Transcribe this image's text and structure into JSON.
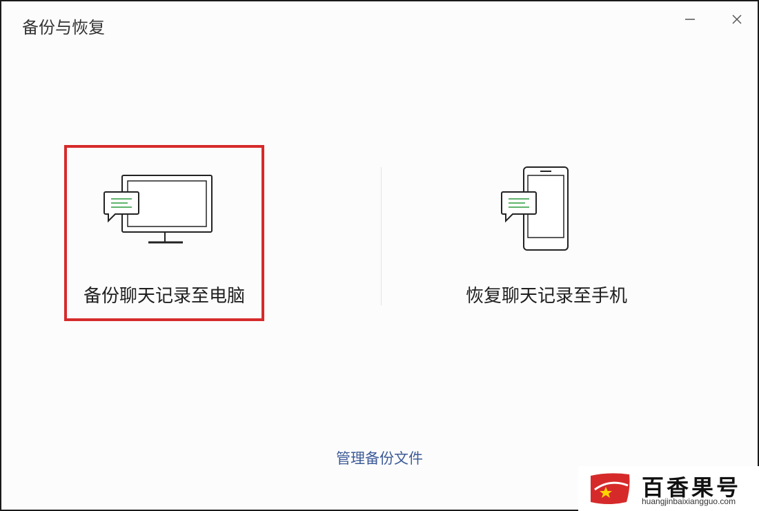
{
  "window": {
    "title": "备份与恢复",
    "minimize_icon": "minimize-icon",
    "close_icon": "close-icon"
  },
  "options": [
    {
      "label": "备份聊天记录至电脑",
      "icon": "monitor-chat-icon",
      "selected": true,
      "highlight_color": "#d62a2a"
    },
    {
      "label": "恢复聊天记录至手机",
      "icon": "phone-chat-icon",
      "selected": false
    }
  ],
  "footer": {
    "manage_link": "管理备份文件"
  },
  "colors": {
    "accent_green": "#2a9a3a",
    "link": "#3d5b97",
    "selection_border": "#d62a2a"
  },
  "watermark": {
    "brand": "百香果号",
    "domain": "huangjinbaixiangguo.com"
  }
}
